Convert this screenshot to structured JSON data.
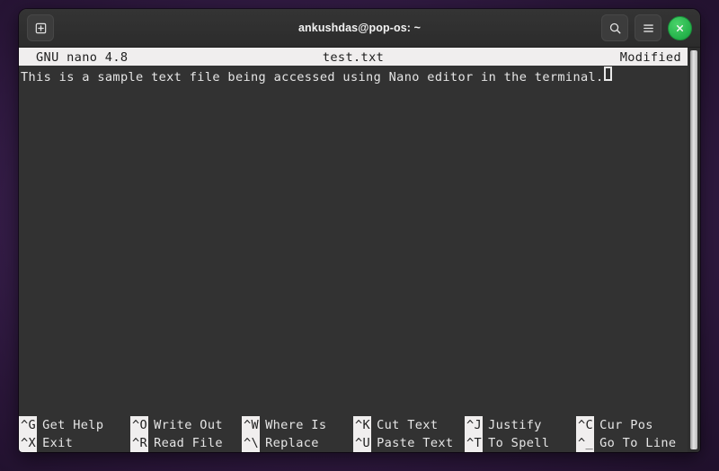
{
  "desktop": {
    "background_color": "#3b2150"
  },
  "window": {
    "title": "ankushdas@pop-os: ~",
    "titlebar": {
      "new_tab_icon": "new-tab-icon",
      "search_icon": "search-icon",
      "menu_icon": "hamburger-menu-icon",
      "close_icon": "close-icon",
      "close_button_color": "#24b14a"
    }
  },
  "nano": {
    "header": {
      "version": "GNU nano 4.8",
      "filename": "test.txt",
      "status": "Modified",
      "background_color": "#f0eeee",
      "text_color": "#1d1d1d"
    },
    "editor": {
      "background_color": "#323232",
      "text_color": "#e6e6e6",
      "lines": [
        "This is a sample text file being accessed using Nano editor in the terminal."
      ]
    },
    "shortcuts_row_1": [
      {
        "key": "^G",
        "label": "Get Help"
      },
      {
        "key": "^O",
        "label": "Write Out"
      },
      {
        "key": "^W",
        "label": "Where Is"
      },
      {
        "key": "^K",
        "label": "Cut Text"
      },
      {
        "key": "^J",
        "label": "Justify"
      },
      {
        "key": "^C",
        "label": "Cur Pos"
      }
    ],
    "shortcuts_row_2": [
      {
        "key": "^X",
        "label": "Exit"
      },
      {
        "key": "^R",
        "label": "Read File"
      },
      {
        "key": "^\\",
        "label": "Replace"
      },
      {
        "key": "^U",
        "label": "Paste Text"
      },
      {
        "key": "^T",
        "label": "To Spell"
      },
      {
        "key": "^_",
        "label": "Go To Line"
      }
    ]
  }
}
